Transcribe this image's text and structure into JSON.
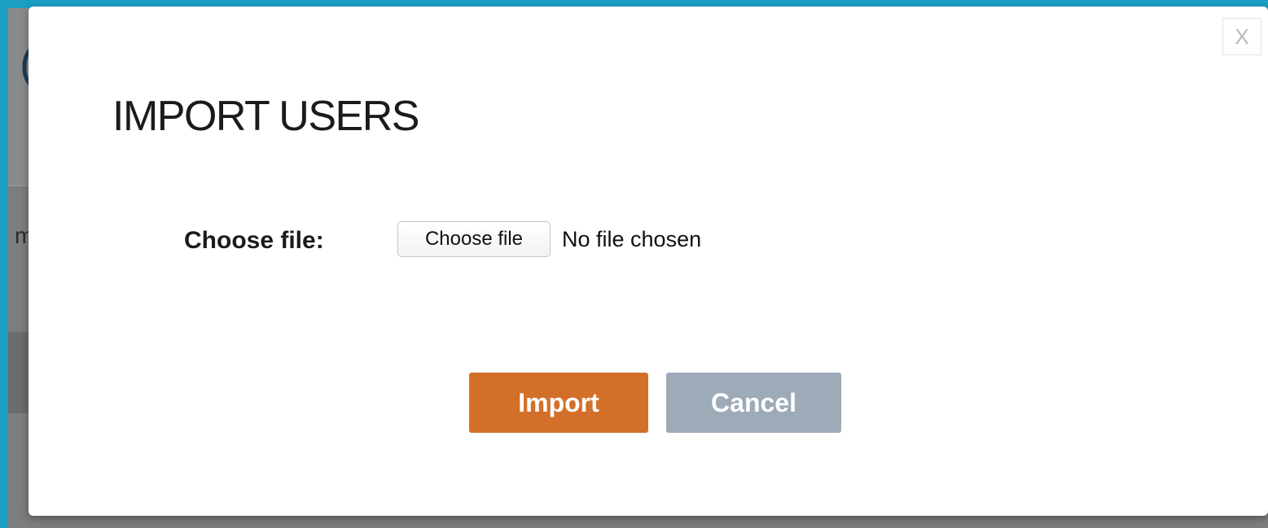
{
  "background": {
    "partial_glyph_top": "(",
    "partial_glyph_mid": "m"
  },
  "modal": {
    "title": "IMPORT USERS",
    "close_label": "X",
    "file_field": {
      "label": "Choose file:",
      "button_label": "Choose file",
      "status_text": "No file chosen"
    },
    "actions": {
      "import_label": "Import",
      "cancel_label": "Cancel"
    }
  },
  "colors": {
    "frame": "#1a9fc3",
    "import_button": "#d2702a",
    "cancel_button": "#9daab8"
  }
}
